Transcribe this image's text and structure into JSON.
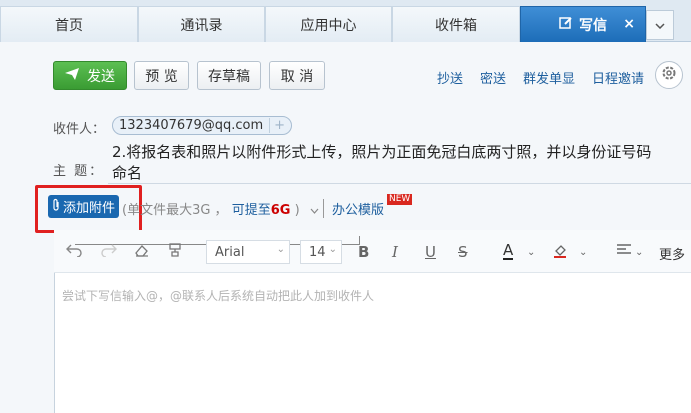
{
  "tabs": [
    {
      "label": "首页"
    },
    {
      "label": "通讯录"
    },
    {
      "label": "应用中心"
    },
    {
      "label": "收件箱"
    },
    {
      "label": "写信",
      "icon": "edit-icon",
      "active": true
    }
  ],
  "tab_close": "×",
  "toolbar": {
    "send_label": "发送",
    "preview_label": "预 览",
    "draft_label": "存草稿",
    "cancel_label": "取 消",
    "cc_label": "抄送",
    "bcc_label": "密送",
    "group_label": "群发单显",
    "schedule_label": "日程邀请"
  },
  "recipient": {
    "label": "收件人：",
    "email": "1323407679@qq.com",
    "add_symbol": "+"
  },
  "subject": {
    "label": "主  题：",
    "text": "2.将报名表和照片以附件形式上传，照片为正面免冠白底两寸照，并以身份证号码命名"
  },
  "attachment": {
    "button_label": "添加附件",
    "limit_prefix": "(单文件最大3G ，",
    "upgrade_label": "可提至",
    "upgrade_size": "6G",
    "limit_suffix": ")",
    "template_label": "办公模版",
    "new_badge": "NEW"
  },
  "format": {
    "font": "Arial",
    "size": "14",
    "bold": "B",
    "italic": "I",
    "underline": "U",
    "strike": "S",
    "font_color": "A",
    "more_label": "更多"
  },
  "editor": {
    "placeholder": "尝试下写信输入@，@联系人后系统自动把此人加到收件人"
  },
  "colors": {
    "accent": "#1a68b0",
    "send": "#3a9c33",
    "highlight": "#e02020"
  }
}
